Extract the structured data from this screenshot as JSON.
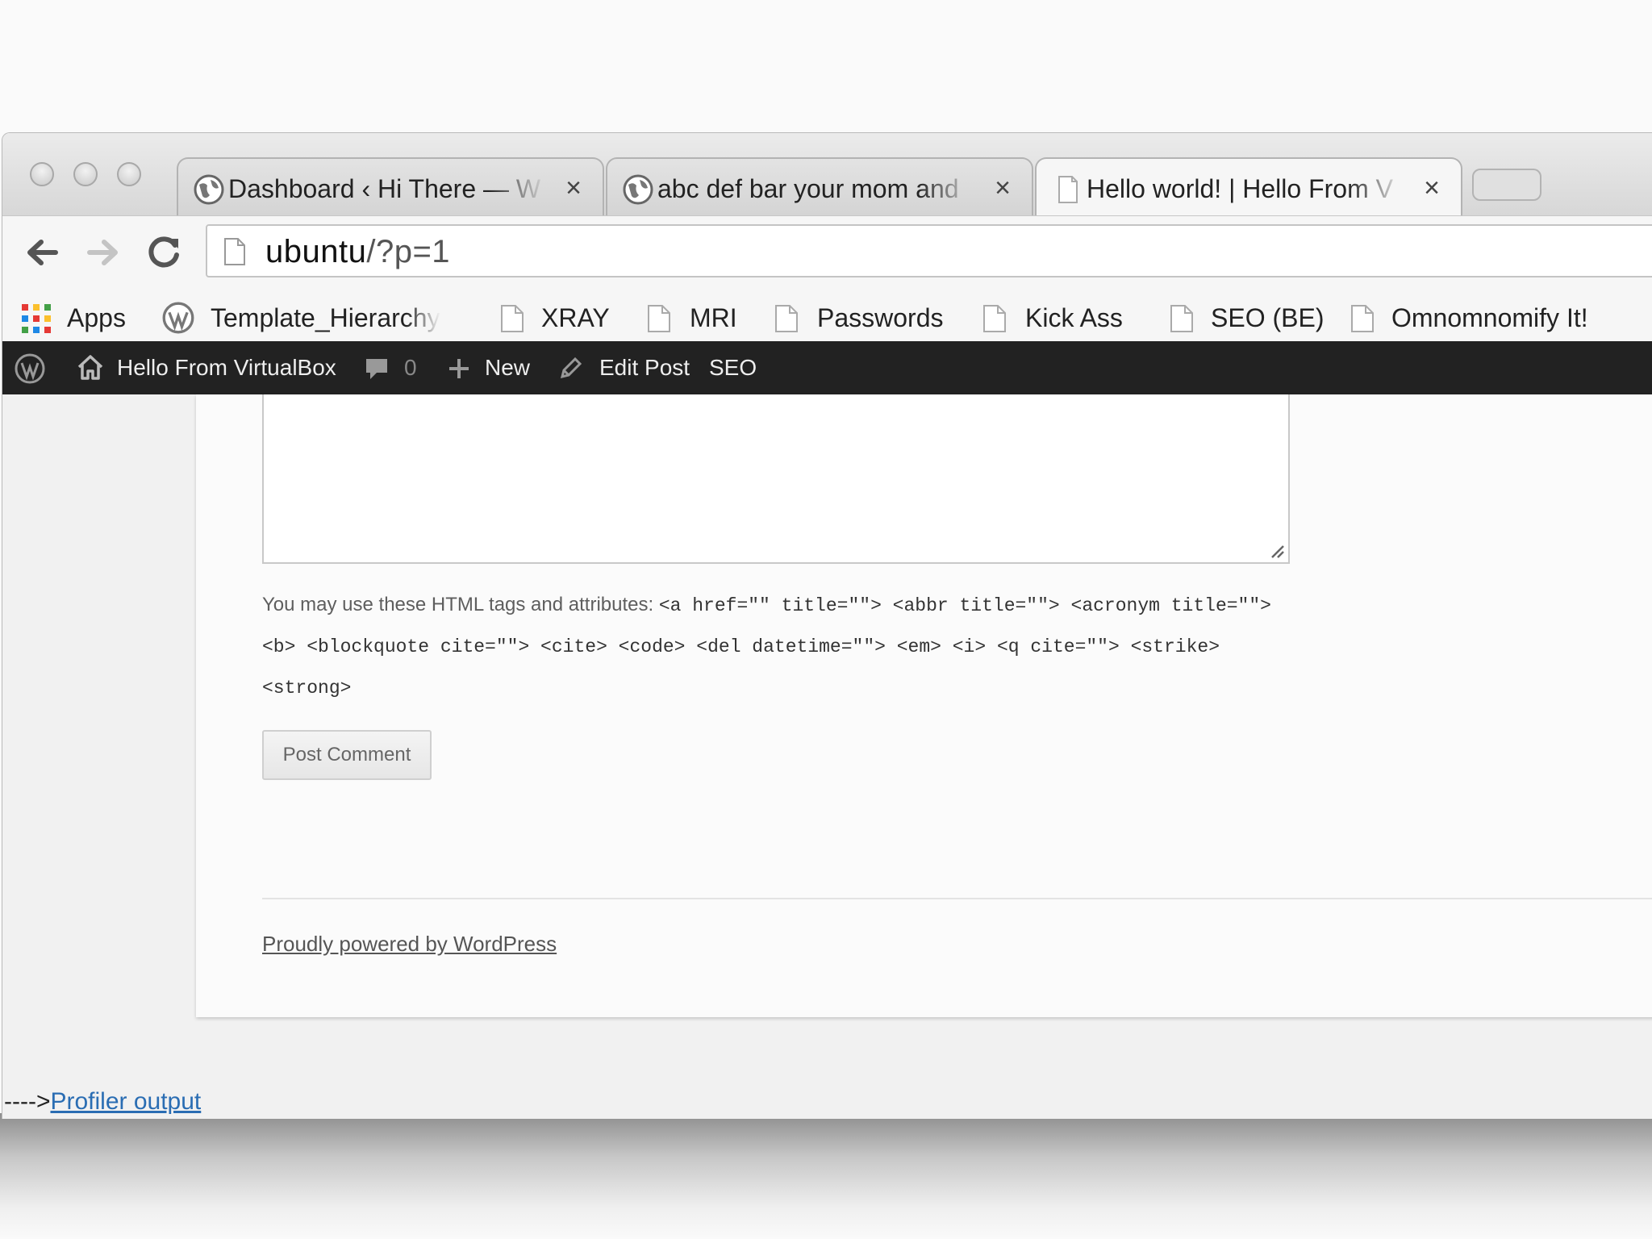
{
  "browser": {
    "tabs": [
      {
        "title": "Dashboard ‹ Hi There — W",
        "icon": "wordpress-globe-icon",
        "active": false
      },
      {
        "title": "abc def bar your mom and",
        "icon": "wordpress-globe-icon",
        "active": false
      },
      {
        "title": "Hello world! | Hello From V",
        "icon": "page-icon",
        "active": true
      }
    ],
    "tab_close_glyph": "×",
    "url_host": "ubuntu",
    "url_path": "/?p=1"
  },
  "bookmarks": [
    {
      "label": "Apps",
      "icon": "apps-grid-icon"
    },
    {
      "label": "Template_Hierarchy",
      "icon": "wordpress-logo-icon"
    },
    {
      "label": "XRAY",
      "icon": "page-icon"
    },
    {
      "label": "MRI",
      "icon": "page-icon"
    },
    {
      "label": "Passwords",
      "icon": "page-icon"
    },
    {
      "label": "Kick Ass",
      "icon": "page-icon"
    },
    {
      "label": "SEO (BE)",
      "icon": "page-icon"
    },
    {
      "label": "Omnomnomify It!",
      "icon": "page-icon"
    }
  ],
  "adminbar": {
    "site_name": "Hello From VirtualBox",
    "comments_count": "0",
    "new_label": "New",
    "edit_label": "Edit Post",
    "seo_label": "SEO"
  },
  "comment_form": {
    "allowed_intro": "You may use these HTML tags and attributes:",
    "allowed_line1": "<a href=\"\" title=\"\"> <abbr title=\"\"> <acronym title=\"\">",
    "allowed_line2": "<b> <blockquote cite=\"\"> <cite> <code> <del datetime=\"\"> <em> <i> <q cite=\"\"> <strike>",
    "allowed_line3": "<strong>",
    "submit_label": "Post Comment"
  },
  "footer": {
    "powered_by": "Proudly powered by WordPress"
  },
  "profiler": {
    "prefix": "---->",
    "link_label": "Profiler output"
  },
  "colors": {
    "adminbar_bg": "#222222",
    "link": "#2a6db3"
  }
}
